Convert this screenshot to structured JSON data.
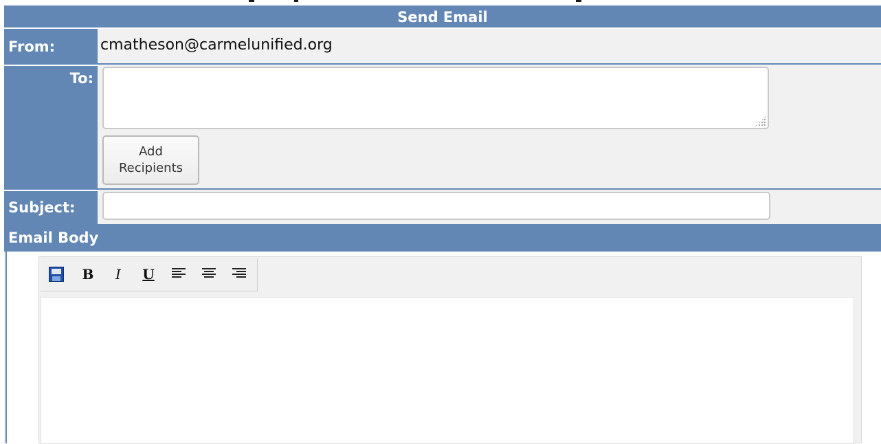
{
  "colors": {
    "header_bg": "#6387b5",
    "label_text": "#ffffff",
    "panel_bg": "#f1f1f1"
  },
  "dialog": {
    "title": "Send Email"
  },
  "from": {
    "label": "From:",
    "value": "cmatheson@carmelunified.org"
  },
  "to": {
    "label": "To:",
    "value": "",
    "add_button_label": "Add\nRecipients"
  },
  "subject": {
    "label": "Subject:",
    "value": ""
  },
  "body": {
    "label": "Email Body",
    "content": "",
    "toolbar": [
      {
        "name": "save-icon"
      },
      {
        "name": "bold-icon",
        "glyph": "B"
      },
      {
        "name": "italic-icon",
        "glyph": "I"
      },
      {
        "name": "underline-icon",
        "glyph": "U"
      },
      {
        "name": "align-left-icon"
      },
      {
        "name": "align-center-icon"
      },
      {
        "name": "align-right-icon"
      }
    ]
  }
}
